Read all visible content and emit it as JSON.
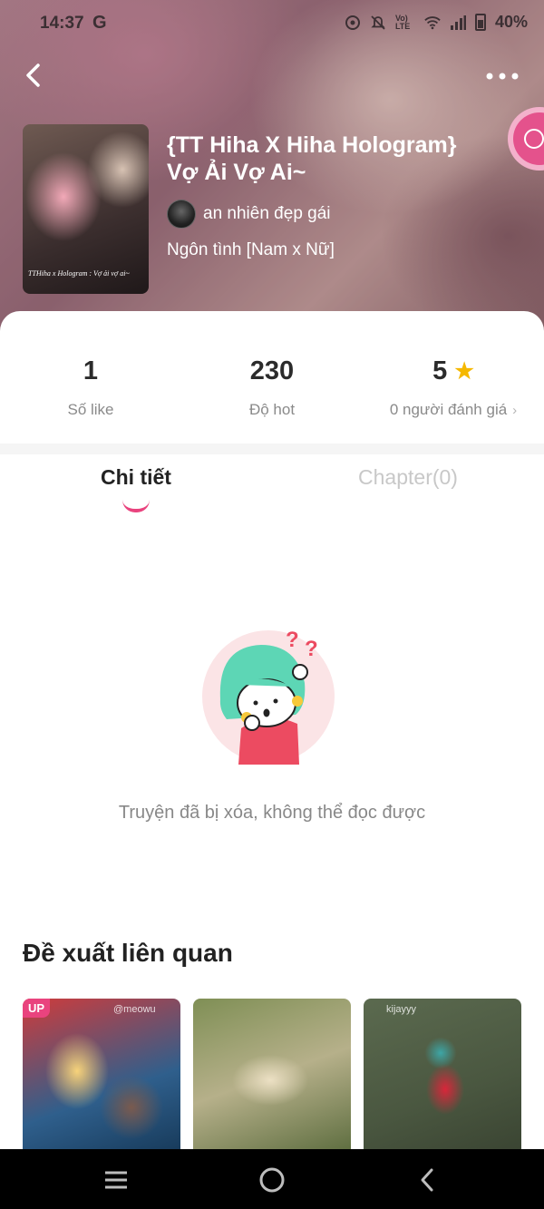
{
  "status_bar": {
    "time": "14:37",
    "carrier_glyph": "G",
    "network_label": "Vo) LTE",
    "battery": "40%",
    "icons": [
      "sync-icon",
      "mute-icon",
      "volte-icon",
      "wifi-icon",
      "signal-icon",
      "battery-icon"
    ]
  },
  "header": {
    "back_icon": "chevron-left-icon",
    "more_icon": "more-icon"
  },
  "story": {
    "cover_caption": "TTHiha x Hologram : Vợ ải vợ ai~",
    "title": "{TT Hiha X Hiha Hologram} Vợ Ải Vợ Ai~",
    "author": "an nhiên đẹp gái",
    "genre": "Ngôn tình [Nam x Nữ]"
  },
  "stats": {
    "likes_value": "1",
    "likes_label": "Số like",
    "hot_value": "230",
    "hot_label": "Độ hot",
    "rating_value": "5",
    "rating_label": "0 người đánh giá"
  },
  "tabs": {
    "details": "Chi tiết",
    "chapters": "Chapter(0)"
  },
  "empty_state": {
    "message": "Truyện đã bị xóa, không thể đọc được"
  },
  "related": {
    "title": "Đề xuất liên quan",
    "items": [
      {
        "badge": "UP",
        "watermark": "@meowu"
      },
      {},
      {
        "watermark": "kijayyy"
      }
    ]
  },
  "colors": {
    "accent": "#e9437e",
    "star": "#f5b800"
  }
}
